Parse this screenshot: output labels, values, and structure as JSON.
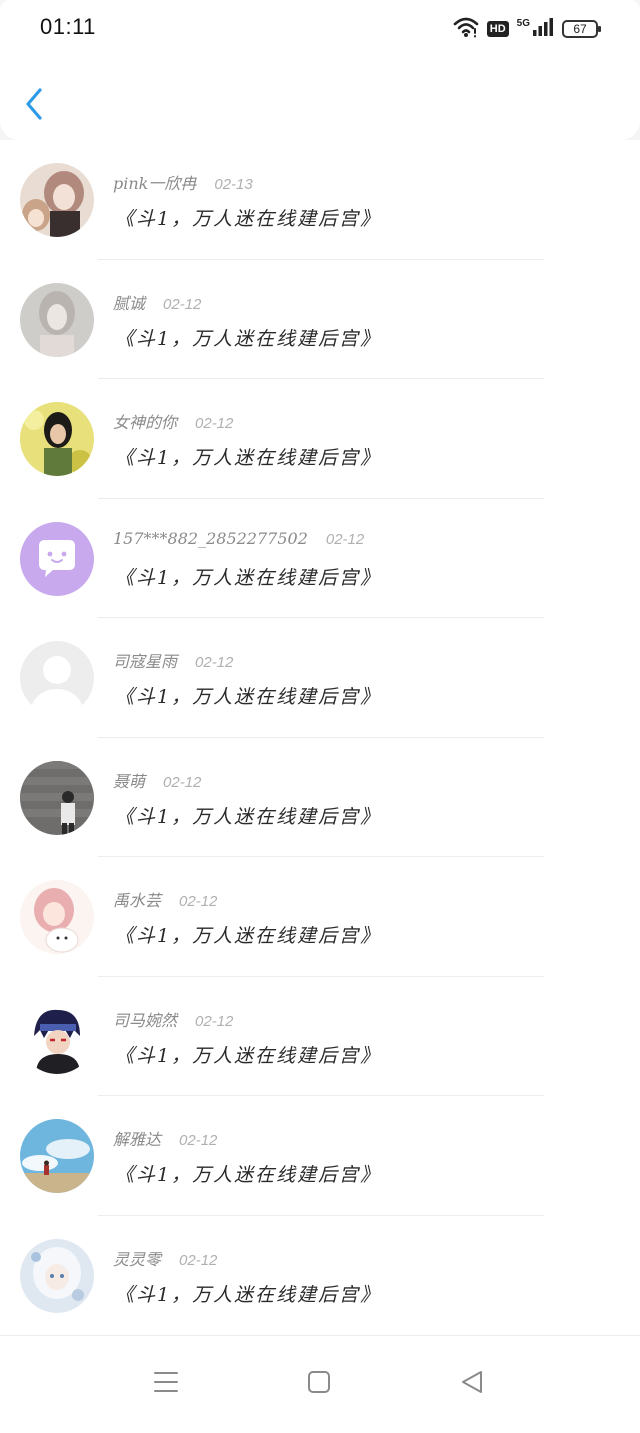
{
  "status_bar": {
    "time": "01:11",
    "network_label": "5G",
    "hd_label": "HD",
    "battery_level": "67",
    "icons": [
      "wifi-icon",
      "hd-badge",
      "signal-icon",
      "battery-icon"
    ]
  },
  "header": {
    "back_icon": "chevron-left-icon",
    "accent_color": "#2f9be8"
  },
  "comments": [
    {
      "name": "pink一欣冉",
      "date": "02-13",
      "message": "《斗1，万人迷在线建后宫》",
      "avatar": "anime-girls-avatar"
    },
    {
      "name": "腻诚",
      "date": "02-12",
      "message": "《斗1，万人迷在线建后宫》",
      "avatar": "pale-girl-avatar"
    },
    {
      "name": "女神的你",
      "date": "02-12",
      "message": "《斗1，万人迷在线建后宫》",
      "avatar": "girl-flowers-avatar"
    },
    {
      "name": "157***882_2852277502",
      "date": "02-12",
      "message": "《斗1，万人迷在线建后宫》",
      "avatar": "default-chat-avatar"
    },
    {
      "name": "司寇星雨",
      "date": "02-12",
      "message": "《斗1，万人迷在线建后宫》",
      "avatar": "empty-person-avatar"
    },
    {
      "name": "聂萌",
      "date": "02-12",
      "message": "《斗1，万人迷在线建后宫》",
      "avatar": "boy-wall-avatar"
    },
    {
      "name": "禹水芸",
      "date": "02-12",
      "message": "《斗1，万人迷在线建后宫》",
      "avatar": "pink-anime-girl-avatar"
    },
    {
      "name": "司马婉然",
      "date": "02-12",
      "message": "《斗1，万人迷在线建后宫》",
      "avatar": "ninja-avatar"
    },
    {
      "name": "解雅达",
      "date": "02-12",
      "message": "《斗1，万人迷在线建后宫》",
      "avatar": "sky-clouds-avatar"
    },
    {
      "name": "灵灵零",
      "date": "02-12",
      "message": "《斗1，万人迷在线建后宫》",
      "avatar": "white-hair-girl-avatar"
    }
  ],
  "nav_bar": {
    "icons": [
      "menu-icon",
      "home-square-icon",
      "back-triangle-icon"
    ]
  }
}
